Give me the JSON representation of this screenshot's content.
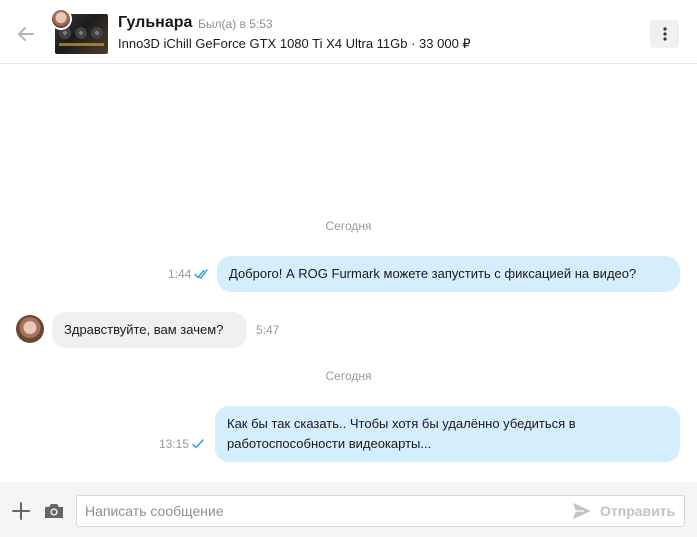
{
  "header": {
    "name": "Гульнара",
    "status": "Был(а) в 5:53",
    "product": "Inno3D iChill GeForce GTX 1080 Ti X4 Ultra 11Gb · 33 000 ₽"
  },
  "messages": [
    {
      "day_label": "Сегодня"
    },
    {
      "direction": "out",
      "text": "Доброго! А ROG Furmark можете запустить с фиксацией на видео?",
      "time": "1:44",
      "read": true
    },
    {
      "direction": "in",
      "text": "Здравствуйте, вам зачем?",
      "time": "5:47"
    },
    {
      "day_label": "Сегодня"
    },
    {
      "direction": "out",
      "text_lines": [
        "Как бы так сказать.. Чтобы хотя бы удалённо убедиться в",
        "работоспособности видеокарты..."
      ],
      "time": "13:15",
      "read": false
    }
  ],
  "composer": {
    "placeholder": "Написать сообщение",
    "send_label": "Отправить"
  },
  "colors": {
    "outgoing_bubble": "#d5eefb",
    "incoming_bubble": "#f0f0f0",
    "check_blue": "#2a9be5",
    "muted": "#9a9a9a"
  }
}
